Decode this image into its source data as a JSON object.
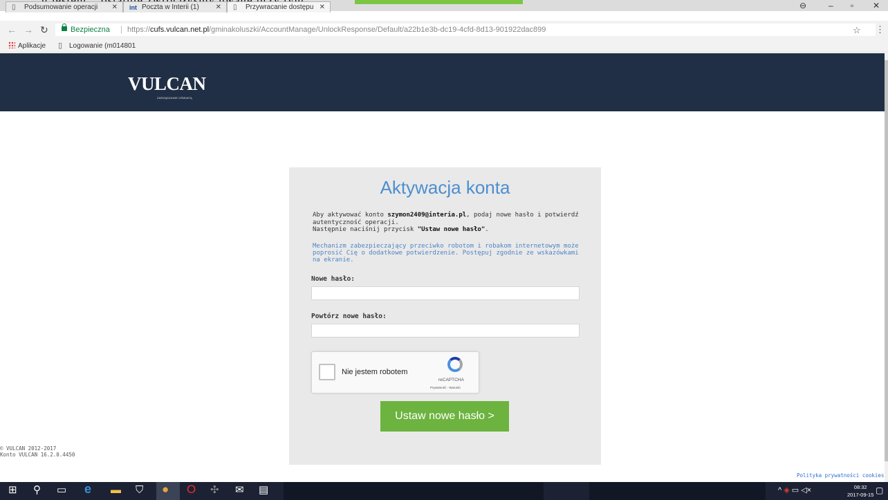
{
  "browser": {
    "overflow_caption": "u jestem... ostatnie zwróciłyśmy uwagę przy tym",
    "tabs": [
      {
        "label": "Podsumowanie operacji",
        "icon": "page-icon"
      },
      {
        "label": "Poczta w Interii (1)",
        "icon": "int"
      },
      {
        "label": "Przywracanie dostępu",
        "icon": "page-icon"
      }
    ],
    "secure_label": "Bezpieczna",
    "url_scheme": "https://",
    "url_host": "cufs.vulcan.net.pl",
    "url_path": "/gminakoluszki/AccountManage/UnlockResponse/Default/a22b1e3b-dc19-4cfd-8d13-901922dac899",
    "bookmarks": {
      "apps_label": "Aplikacje",
      "items": [
        "Logowanie (m014801"
      ]
    }
  },
  "header": {
    "logo": "VULCAN",
    "logo_subtitle": "ZARZĄDZANIE OŚWIATĄ"
  },
  "form": {
    "title": "Aktywacja konta",
    "intro_prefix": "Aby aktywować konto ",
    "account_email": "szymon2409@interia.pl",
    "intro_suffix": ", podaj nowe hasło i potwierdź autentyczność operacji.",
    "instruction_prefix": "Następnie naciśnij przycisk ",
    "instruction_button": "\"Ustaw nowe hasło\"",
    "instruction_suffix": ".",
    "note": "Mechanizm zabezpieczający przeciwko robotom i robakom internetowym może poprosić Cię o dodatkowe potwierdzenie. Postępuj zgodnie ze wskazówkami na ekranie.",
    "new_password_label": "Nowe hasło:",
    "new_password_value": "",
    "repeat_password_label": "Powtórz nowe hasło:",
    "repeat_password_value": "",
    "captcha_label": "Nie jestem robotem",
    "captcha_brand": "reCAPTCHA",
    "captcha_links": "Prywatność - Warunki",
    "submit_label": "Ustaw nowe hasło >"
  },
  "footer": {
    "copyright": "© VULCAN 2012-2017",
    "version": "Konto VULCAN 16.2.0.4450",
    "cookies_link": "Polityka prywatności cookies"
  },
  "taskbar": {
    "time": "08:32",
    "date": "2017-09-15"
  },
  "colors": {
    "header_bg": "#202f45",
    "title_blue": "#4d8ed0",
    "button_green": "#6cb33f",
    "panel_bg": "#e9e9e9"
  }
}
